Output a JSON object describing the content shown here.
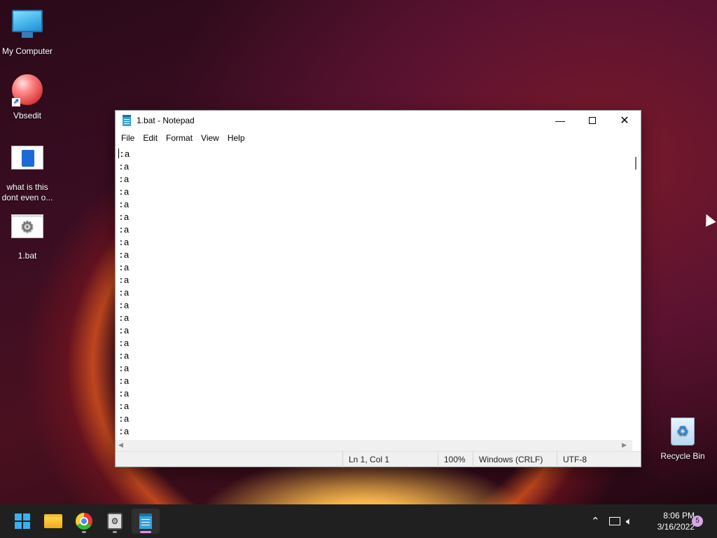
{
  "desktop": {
    "icons": [
      {
        "label": "My Computer"
      },
      {
        "label": "Vbsedit"
      },
      {
        "label": "what is this dont even o..."
      },
      {
        "label": "1.bat"
      }
    ],
    "recycle_bin": {
      "label": "Recycle Bin"
    }
  },
  "notepad": {
    "title": "1.bat - Notepad",
    "menu": [
      "File",
      "Edit",
      "Format",
      "View",
      "Help"
    ],
    "lines": [
      ":a",
      ":a",
      ":a",
      ":a",
      ":a",
      ":a",
      ":a",
      ":a",
      ":a",
      ":a",
      ":a",
      ":a",
      ":a",
      ":a",
      ":a",
      ":a",
      ":a",
      ":a",
      ":a",
      ":a",
      ":a",
      ":a",
      ":a"
    ],
    "status": {
      "position": "Ln 1, Col 1",
      "zoom": "100%",
      "line_ending": "Windows (CRLF)",
      "encoding": "UTF-8"
    }
  },
  "taskbar": {
    "time": "8:06 PM",
    "date": "3/16/2022",
    "notification_count": "5",
    "apps": [
      "start-icon",
      "file-explorer-icon",
      "chrome-icon",
      "vbsedit-icon",
      "notepad-icon"
    ]
  },
  "colors": {
    "taskbar": "#202020",
    "accent": "#3ab0f0"
  }
}
